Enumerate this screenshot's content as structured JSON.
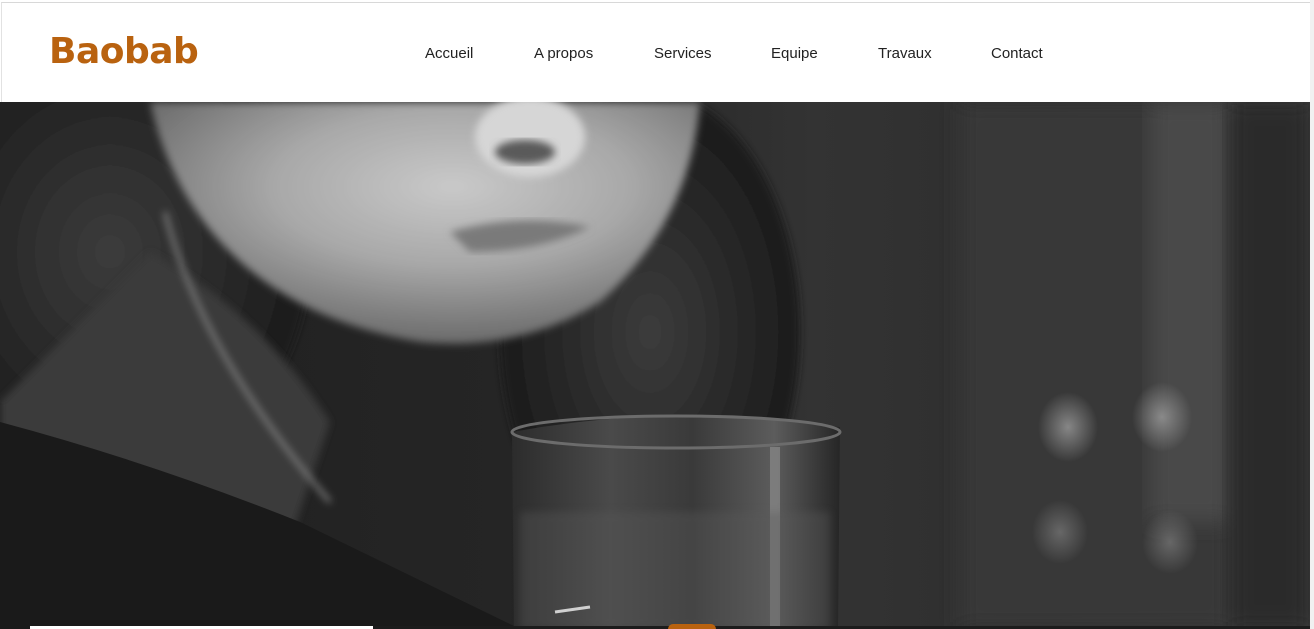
{
  "brand": {
    "name": "Baobab",
    "color": "#b9620f"
  },
  "nav": {
    "items": [
      {
        "label": "Accueil"
      },
      {
        "label": "A propos"
      },
      {
        "label": "Services"
      },
      {
        "label": "Equipe"
      },
      {
        "label": "Travaux"
      },
      {
        "label": "Contact"
      }
    ]
  },
  "hero": {
    "image": "black-and-white photo of a woman with curly hair drinking from a glass",
    "tone": "grayscale"
  },
  "colors": {
    "accent": "#b9620f",
    "nav_text": "#222222",
    "background": "#ffffff"
  }
}
